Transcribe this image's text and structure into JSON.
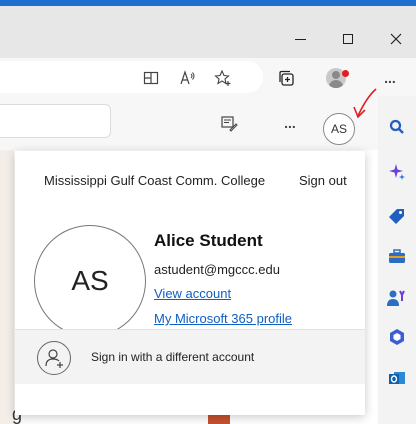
{
  "window": {
    "minimize_icon": "minimize-icon",
    "maximize_icon": "maximize-icon",
    "close_icon": "close-icon"
  },
  "toolbar": {
    "icons": [
      "split-screen-icon",
      "read-aloud-icon",
      "add-favorite-icon",
      "collections-icon",
      "profile-icon",
      "more-icon"
    ],
    "more_label": "..."
  },
  "toolbar2": {
    "more_label": "...",
    "profile_initials": "AS"
  },
  "account": {
    "org": "Mississippi Gulf Coast Comm. College",
    "sign_out": "Sign out",
    "initials": "AS",
    "name": "Alice Student",
    "email": "astudent@mgccc.edu",
    "view_account": "View account",
    "m365_profile": "My Microsoft 365 profile",
    "different_account": "Sign in with a different account"
  },
  "page": {
    "partial_text": "g"
  },
  "colors": {
    "accent": "#1f6fd0",
    "link": "#0f5fc5",
    "annotation_arrow": "#e02020"
  }
}
